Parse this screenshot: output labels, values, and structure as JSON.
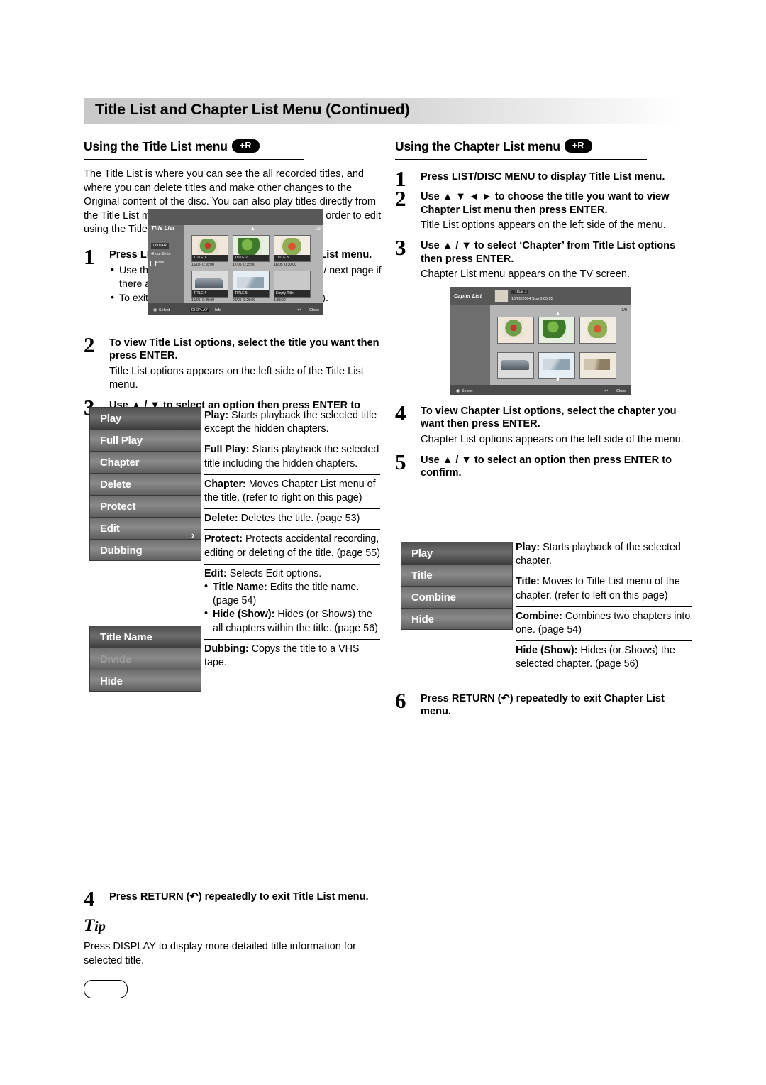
{
  "header": {
    "title": "Title List and Chapter List Menu (Continued)"
  },
  "left": {
    "section_title": "Using the Title List menu",
    "badge": "+R",
    "intro": "The Title List is where you can see the all recorded titles, and where you can delete titles and make other changes to the Original content of the disc. You can also play titles directly from the Title List menu. The recorder must be stopped in order to edit using the Title List menu.",
    "steps": [
      {
        "num": "1",
        "title": "Press LIST/DISC MENU to display the Title List menu.",
        "bullets": [
          "Use the ▲ / ▼ buttons to display the previous/ next page if there are more than 6 titles.",
          "To exit the Title List menu, press RETURN (↶)."
        ]
      },
      {
        "num": "2",
        "title": "To view Title List options, select the title you want then press ENTER.",
        "body": "Title List options appears on the left side of the Title List menu."
      },
      {
        "num": "3",
        "title": "Use ▲ / ▼ to select an option then press ENTER to confirm."
      },
      {
        "num": "4",
        "title": "Press RETURN (↶) repeatedly to exit Title List menu."
      }
    ],
    "menu_options": [
      "Play",
      "Full Play",
      "Chapter",
      "Delete",
      "Protect",
      "Edit",
      "Dubbing"
    ],
    "submenu_options": [
      "Title Name",
      "Divide",
      "Hide"
    ],
    "descriptions": [
      {
        "label": "Play:",
        "text": " Starts playback the selected title except the hidden chapters."
      },
      {
        "label": "Full Play:",
        "text": " Starts playback the selected title including the hidden chapters."
      },
      {
        "label": "Chapter:",
        "text": " Moves Chapter List menu of the title. (refer to right on this page)"
      },
      {
        "label": "Delete:",
        "text": " Deletes the title. (page 53)"
      },
      {
        "label": "Protect:",
        "text": " Protects accidental recording, editing or deleting of the title. (page 55)"
      },
      {
        "label": "Edit:",
        "text": " Selects Edit options."
      },
      {
        "label": "Dubbing:",
        "text": " Copys the title to a VHS tape."
      }
    ],
    "edit_bullets": [
      {
        "label": "Title Name:",
        "text": " Edits the title name. (page 54)"
      },
      {
        "label": "Hide (Show):",
        "text": " Hides (or Shows) the all chapters within the title. (page 56)"
      }
    ],
    "tip_head": "Tip",
    "tip_body": "Press DISPLAY to display more detailed title information for selected title."
  },
  "right": {
    "section_title": "Using the Chapter List menu",
    "badge": "+R",
    "steps": [
      {
        "num": "1",
        "title": "Press LIST/DISC MENU to display Title List menu."
      },
      {
        "num": "2",
        "title": "Use ▲ ▼ ◄ ► to choose the title you want to view Chapter List menu then press ENTER.",
        "body": "Title List options appears on the left side of the menu."
      },
      {
        "num": "3",
        "title": "Use ▲ / ▼ to select ‘Chapter’ from Title List options then press ENTER.",
        "body": "Chapter List menu appears on the TV screen."
      },
      {
        "num": "4",
        "title": "To view Chapter List options, select the chapter you want then press ENTER.",
        "body": "Chapter List options appears on the left side of the menu."
      },
      {
        "num": "5",
        "title": "Use ▲ / ▼ to select an option then press ENTER to confirm."
      },
      {
        "num": "6",
        "title": "Press RETURN (↶) repeatedly to exit Chapter List menu."
      }
    ],
    "menu_options": [
      "Play",
      "Title",
      "Combine",
      "Hide"
    ],
    "descriptions": [
      {
        "label": "Play:",
        "text": " Starts playback of the selected chapter."
      },
      {
        "label": "Title:",
        "text": " Moves to Title List menu of the chapter. (refer to left on this page)"
      },
      {
        "label": "Combine:",
        "text": " Combines two chapters into one. (page 54)"
      },
      {
        "label": "Hide (Show):",
        "text": " Hides (or Shows) the selected chapter. (page 56)"
      }
    ]
  },
  "osd_title_list": {
    "label": "Title List",
    "disc_type": "DVD+R",
    "time_left": "4hour 8min",
    "free": "Free",
    "page": "1/8",
    "cells": [
      {
        "name": "TITLE 1",
        "date": "16/05",
        "time": "0:16:00"
      },
      {
        "name": "TITLE 2",
        "date": "17/05",
        "time": "0:35:00"
      },
      {
        "name": "TITLE 3",
        "date": "18/05",
        "time": "0:30:00"
      },
      {
        "name": "TITLE 4",
        "date": "19/05",
        "time": "0:45:00"
      },
      {
        "name": "TITLE 5",
        "date": "20/05",
        "time": "0:25:00"
      },
      {
        "name": "Empty Title",
        "date": "",
        "time": "1:38:00"
      }
    ],
    "footer_select": "Select",
    "footer_display": "DISPLAY",
    "footer_info": "Info",
    "footer_close": "Close"
  },
  "osd_chapter_list": {
    "label": "Capter List",
    "title_name": "TITLE 1",
    "title_info": "16/05/2004 Sun 0:05:55",
    "page": "1/9",
    "footer_select": "Select",
    "footer_close": "Close"
  },
  "page_number": ""
}
